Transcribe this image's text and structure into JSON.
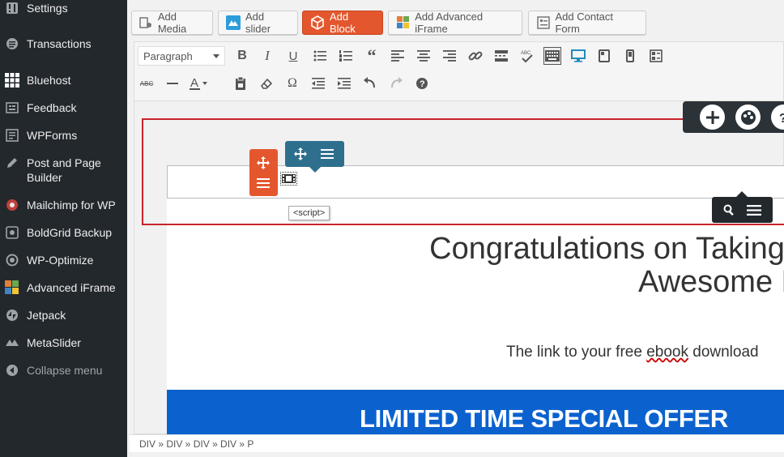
{
  "sidebar": {
    "items": [
      {
        "label": "Settings",
        "icon": "settings-icon"
      },
      {
        "label": "Transactions",
        "icon": "transactions-icon"
      },
      {
        "label": "Bluehost",
        "icon": "bluehost-grid-icon"
      },
      {
        "label": "Feedback",
        "icon": "feedback-icon"
      },
      {
        "label": "WPForms",
        "icon": "wpforms-icon"
      },
      {
        "label": "Post and Page Builder",
        "icon": "pencil-icon"
      },
      {
        "label": "Mailchimp for WP",
        "icon": "mailchimp-icon"
      },
      {
        "label": "BoldGrid Backup",
        "icon": "backup-icon"
      },
      {
        "label": "WP-Optimize",
        "icon": "optimize-icon"
      },
      {
        "label": "Advanced iFrame",
        "icon": "iframe-icon"
      },
      {
        "label": "Jetpack",
        "icon": "jetpack-icon"
      },
      {
        "label": "MetaSlider",
        "icon": "metaslider-icon"
      }
    ],
    "collapse_label": "Collapse menu"
  },
  "media_buttons": {
    "add_media": "Add Media",
    "add_slider": "Add slider",
    "add_block": "Add Block",
    "add_iframe": "Add Advanced iFrame",
    "add_contact_form": "Add Contact Form"
  },
  "toolbar": {
    "format_select": "Paragraph"
  },
  "editor": {
    "script_tooltip": "<script>",
    "hero_line1": "Congratulations on Taking t",
    "hero_line2": "Awesome P",
    "sub_before": "The link to your free ",
    "sub_misspelled": "ebook",
    "sub_after": " download",
    "offer": "LIMITED TIME SPECIAL OFFER"
  },
  "status": {
    "path": "DIV » DIV » DIV » DIV » P"
  },
  "colors": {
    "sidebar_bg": "#23282d",
    "accent_orange": "#e4572e",
    "control_blue": "#2e6f8e",
    "offer_blue": "#0b62cf",
    "selection_red": "#c9232a"
  }
}
